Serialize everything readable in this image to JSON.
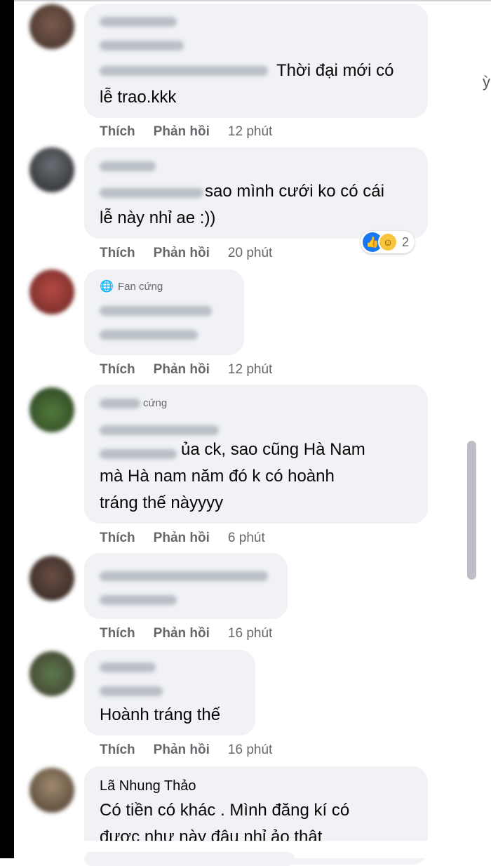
{
  "actions": {
    "like": "Thích",
    "reply": "Phản hồi"
  },
  "comments": [
    {
      "text": "Thời đại mới có\nlễ trao.kkk",
      "time": "12 phút"
    },
    {
      "text": "sao mình cưới ko có cái\nlễ này nhỉ ae :))",
      "time": "20 phút",
      "reaction_count": "2"
    },
    {
      "fan_tag": "Fan cứng",
      "time": "12 phút"
    },
    {
      "fan_tag": "cứng",
      "text": "ủa ck, sao cũng Hà Nam\nmà Hà nam năm đó k có hoành\ntráng thế nàyyyy",
      "time": "6 phút"
    },
    {
      "time": "16 phút"
    },
    {
      "text": "Hoành tráng thế",
      "time": "16 phút"
    },
    {
      "author": "Lã Nhung Thảo",
      "text": "Có tiền có khác . Mình đăng kí có\nđược như này đâu nhỉ ảo thật"
    }
  ],
  "reactions": {
    "icons": [
      "like-icon",
      "haha-icon"
    ]
  },
  "colors": {
    "bubble": "#f0f2f5",
    "meta": "#65676b",
    "like_blue": "#1877f2",
    "haha_yellow": "#f7c53b"
  }
}
